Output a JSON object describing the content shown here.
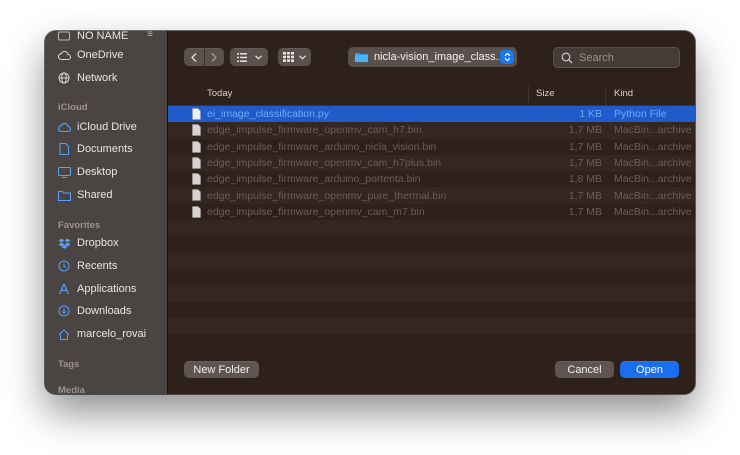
{
  "sidebar": {
    "top_items": [
      {
        "label": "NO NAME",
        "icon": "drive-icon"
      },
      {
        "label": "OneDrive",
        "icon": "cloud-icon"
      },
      {
        "label": "Network",
        "icon": "globe-icon"
      }
    ],
    "sections": {
      "icloud": "iCloud",
      "favorites": "Favorites",
      "tags": "Tags",
      "media": "Media"
    },
    "icloud_items": [
      {
        "label": "iCloud Drive",
        "icon": "cloud-icon"
      },
      {
        "label": "Documents",
        "icon": "document-icon"
      },
      {
        "label": "Desktop",
        "icon": "desktop-icon"
      },
      {
        "label": "Shared",
        "icon": "shared-folder-icon"
      }
    ],
    "favorite_items": [
      {
        "label": "Dropbox",
        "icon": "dropbox-icon"
      },
      {
        "label": "Recents",
        "icon": "clock-icon"
      },
      {
        "label": "Applications",
        "icon": "applications-icon"
      },
      {
        "label": "Downloads",
        "icon": "download-icon"
      },
      {
        "label": "marcelo_rovai",
        "icon": "home-icon"
      }
    ]
  },
  "toolbar": {
    "path": "nicla-vision_image_class...",
    "search_placeholder": "Search"
  },
  "columns": {
    "name": "Today",
    "size": "Size",
    "kind": "Kind"
  },
  "files": [
    {
      "name": "ei_image_classification.py",
      "size": "1 KB",
      "kind": "Python File",
      "selected": true
    },
    {
      "name": "edge_impulse_firmware_openmv_cam_h7.bin",
      "size": "1,7 MB",
      "kind": "MacBin...archive",
      "selected": false
    },
    {
      "name": "edge_impulse_firmware_arduino_nicla_vision.bin",
      "size": "1,7 MB",
      "kind": "MacBin...archive",
      "selected": false
    },
    {
      "name": "edge_impulse_firmware_openmv_cam_h7plus.bin",
      "size": "1,7 MB",
      "kind": "MacBin...archive",
      "selected": false
    },
    {
      "name": "edge_impulse_firmware_arduino_portenta.bin",
      "size": "1,8 MB",
      "kind": "MacBin...archive",
      "selected": false
    },
    {
      "name": "edge_impulse_firmware_openmv_pure_thermal.bin",
      "size": "1,7 MB",
      "kind": "MacBin...archive",
      "selected": false
    },
    {
      "name": "edge_impulse_firmware_openmv_cam_m7.bin",
      "size": "1,7 MB",
      "kind": "MacBin...archive",
      "selected": false
    }
  ],
  "buttons": {
    "new_folder": "New Folder",
    "cancel": "Cancel",
    "open": "Open"
  },
  "colors": {
    "accent": "#1a6ff0",
    "selection": "#1f5cc9",
    "sidebar_icon": "#5aa0ff"
  }
}
